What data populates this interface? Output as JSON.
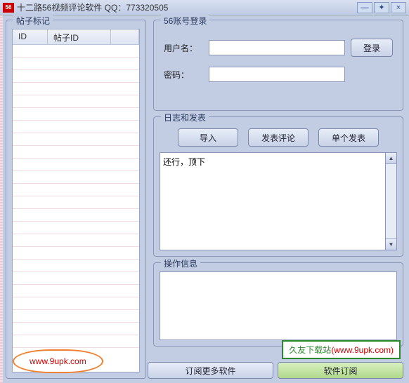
{
  "title": "十二路56视频评论软件   QQ：773320505",
  "icon_text": "56",
  "group_posts": {
    "legend": "帖子标记",
    "columns": [
      "ID",
      "帖子ID"
    ]
  },
  "group_login": {
    "legend": "56账号登录",
    "username_label": "用户名：",
    "password_label": "密码：",
    "username_value": "",
    "password_value": "",
    "login_button": "登录"
  },
  "group_post": {
    "legend": "日志和发表",
    "import_button": "导入",
    "comment_button": "发表评论",
    "single_button": "单个发表",
    "content": "还行，顶下"
  },
  "group_log": {
    "legend": "操作信息"
  },
  "bottom": {
    "subscribe": "订阅更多软件",
    "soft_sub": "软件订阅"
  },
  "watermark1": "www.9upk.com",
  "watermark2_a": "久友下载站",
  "watermark2_b": "(www.9upk.com)"
}
